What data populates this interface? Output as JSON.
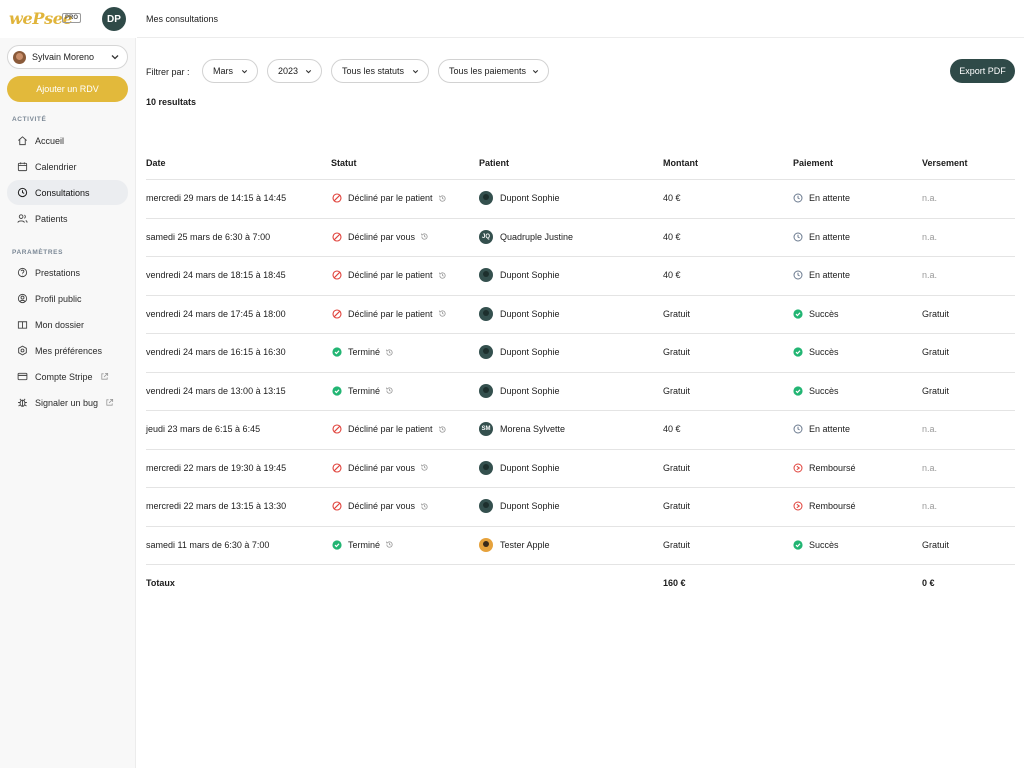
{
  "app": {
    "logo": "wePsee",
    "pro_badge": "PRO",
    "user_initials": "DP"
  },
  "user_selector": {
    "name": "Sylvain Moreno"
  },
  "add_button": "Ajouter un RDV",
  "sidebar": {
    "activity_label": "ACTIVITÉ",
    "activity_items": [
      {
        "label": "Accueil",
        "icon": "home-icon"
      },
      {
        "label": "Calendrier",
        "icon": "calendar-icon"
      },
      {
        "label": "Consultations",
        "icon": "clock-icon"
      },
      {
        "label": "Patients",
        "icon": "users-icon"
      }
    ],
    "settings_label": "PARAMÈTRES",
    "settings_items": [
      {
        "label": "Prestations",
        "icon": "tag-icon"
      },
      {
        "label": "Profil public",
        "icon": "profile-icon"
      },
      {
        "label": "Mon dossier",
        "icon": "folder-icon"
      },
      {
        "label": "Mes préférences",
        "icon": "gear-icon"
      },
      {
        "label": "Compte Stripe",
        "icon": "card-icon"
      },
      {
        "label": "Signaler un bug",
        "icon": "bug-icon"
      }
    ]
  },
  "header": {
    "title": "Mes consultations"
  },
  "filters": {
    "label": "Filtrer par :",
    "month": "Mars",
    "year": "2023",
    "status": "Tous les statuts",
    "payment": "Tous les paiements",
    "export": "Export PDF"
  },
  "results": "10 resultats",
  "table": {
    "headers": [
      "Date",
      "Statut",
      "Patient",
      "Montant",
      "Paiement",
      "Versement"
    ],
    "rows": [
      {
        "date": "mercredi 29 mars de 14:15 à 14:45",
        "status": "Décliné par le patient",
        "status_type": "declined",
        "patient": "Dupont Sophie",
        "avatar": "",
        "amount": "40 €",
        "payment": "En attente",
        "payment_type": "pending",
        "versement": "n.a."
      },
      {
        "date": "samedi 25 mars de 6:30 à 7:00",
        "status": "Décliné par vous",
        "status_type": "declined",
        "patient": "Quadruple Justine",
        "avatar": "JQ",
        "amount": "40 €",
        "payment": "En attente",
        "payment_type": "pending",
        "versement": "n.a."
      },
      {
        "date": "vendredi 24 mars de 18:15 à 18:45",
        "status": "Décliné par le patient",
        "status_type": "declined",
        "patient": "Dupont Sophie",
        "avatar": "",
        "amount": "40 €",
        "payment": "En attente",
        "payment_type": "pending",
        "versement": "n.a."
      },
      {
        "date": "vendredi 24 mars de 17:45 à 18:00",
        "status": "Décliné par le patient",
        "status_type": "declined",
        "patient": "Dupont Sophie",
        "avatar": "",
        "amount": "Gratuit",
        "payment": "Succès",
        "payment_type": "success",
        "versement": "Gratuit"
      },
      {
        "date": "vendredi 24 mars de 16:15 à 16:30",
        "status": "Terminé",
        "status_type": "done",
        "patient": "Dupont Sophie",
        "avatar": "",
        "amount": "Gratuit",
        "payment": "Succès",
        "payment_type": "success",
        "versement": "Gratuit"
      },
      {
        "date": "vendredi 24 mars de 13:00 à 13:15",
        "status": "Terminé",
        "status_type": "done",
        "patient": "Dupont Sophie",
        "avatar": "",
        "amount": "Gratuit",
        "payment": "Succès",
        "payment_type": "success",
        "versement": "Gratuit"
      },
      {
        "date": "jeudi 23 mars de 6:15 à 6:45",
        "status": "Décliné par le patient",
        "status_type": "declined",
        "patient": "Morena Sylvette",
        "avatar": "SM",
        "amount": "40 €",
        "payment": "En attente",
        "payment_type": "pending",
        "versement": "n.a."
      },
      {
        "date": "mercredi 22 mars de 19:30 à 19:45",
        "status": "Décliné par vous",
        "status_type": "declined",
        "patient": "Dupont Sophie",
        "avatar": "",
        "amount": "Gratuit",
        "payment": "Remboursé",
        "payment_type": "refunded",
        "versement": "n.a."
      },
      {
        "date": "mercredi 22 mars de 13:15 à 13:30",
        "status": "Décliné par vous",
        "status_type": "declined",
        "patient": "Dupont Sophie",
        "avatar": "",
        "amount": "Gratuit",
        "payment": "Remboursé",
        "payment_type": "refunded",
        "versement": "n.a."
      },
      {
        "date": "samedi 11 mars de 6:30 à 7:00",
        "status": "Terminé",
        "status_type": "done",
        "patient": "Tester Apple",
        "avatar": "",
        "amount": "Gratuit",
        "payment": "Succès",
        "payment_type": "success",
        "versement": "Gratuit"
      }
    ],
    "totals": {
      "label": "Totaux",
      "amount": "160 €",
      "versement": "0 €"
    }
  },
  "colors": {
    "accent": "#e2b93b",
    "primary": "#2f4a48",
    "declined": "#e0413a",
    "success": "#22b573",
    "pending": "#6b7a8f"
  }
}
